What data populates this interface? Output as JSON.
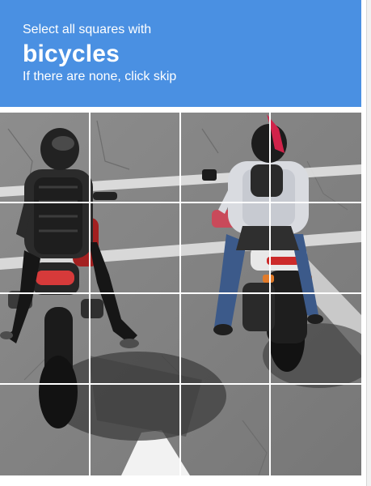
{
  "challenge": {
    "line1": "Select all squares with",
    "target": "bicycles",
    "line3": "If there are none, click skip"
  },
  "colors": {
    "header_bg": "#4a90e2",
    "header_text": "#ffffff"
  },
  "grid": {
    "rows": 4,
    "cols": 4
  }
}
